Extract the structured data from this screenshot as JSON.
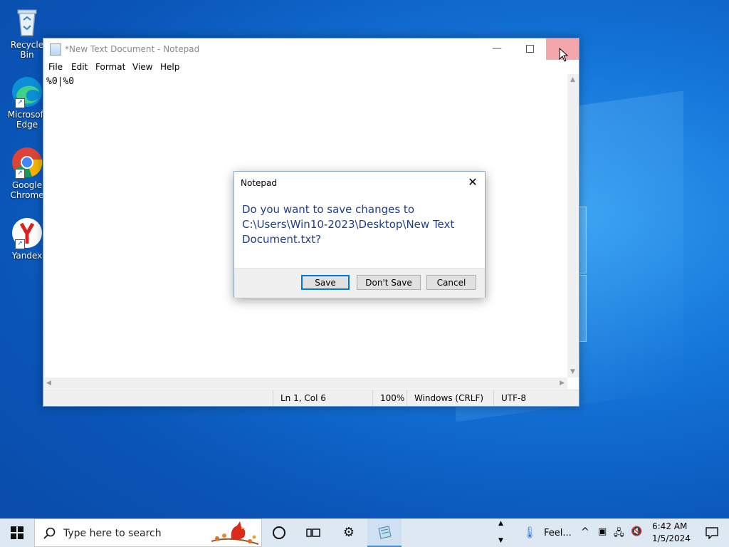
{
  "desktop": {
    "icons": [
      {
        "label": "Recycle Bin",
        "icon": "recycle-bin-icon"
      },
      {
        "label": "Microsoft Edge",
        "icon": "edge-icon"
      },
      {
        "label": "Google Chrome",
        "icon": "chrome-icon"
      },
      {
        "label": "Yandex",
        "icon": "yandex-icon"
      }
    ]
  },
  "notepad": {
    "title": "*New Text Document - Notepad",
    "menu": [
      "File",
      "Edit",
      "Format",
      "View",
      "Help"
    ],
    "content": "%0|%0",
    "status": {
      "position": "Ln 1, Col 6",
      "zoom": "100%",
      "line_ending": "Windows (CRLF)",
      "encoding": "UTF-8"
    }
  },
  "dialog": {
    "title": "Notepad",
    "close_glyph": "✕",
    "message": "Do you want to save changes to C:\\Users\\Win10-2023\\Desktop\\New Text Document.txt?",
    "buttons": {
      "save": "Save",
      "dont_save": "Don't Save",
      "cancel": "Cancel"
    }
  },
  "taskbar": {
    "search_placeholder": "Type here to search",
    "weather": "Feel...",
    "time": "6:42 AM",
    "date": "1/5/2024"
  },
  "colors": {
    "accent": "#0078d7",
    "dialog_text": "#1f3f8a",
    "close_hover": "#f4a6ad"
  }
}
